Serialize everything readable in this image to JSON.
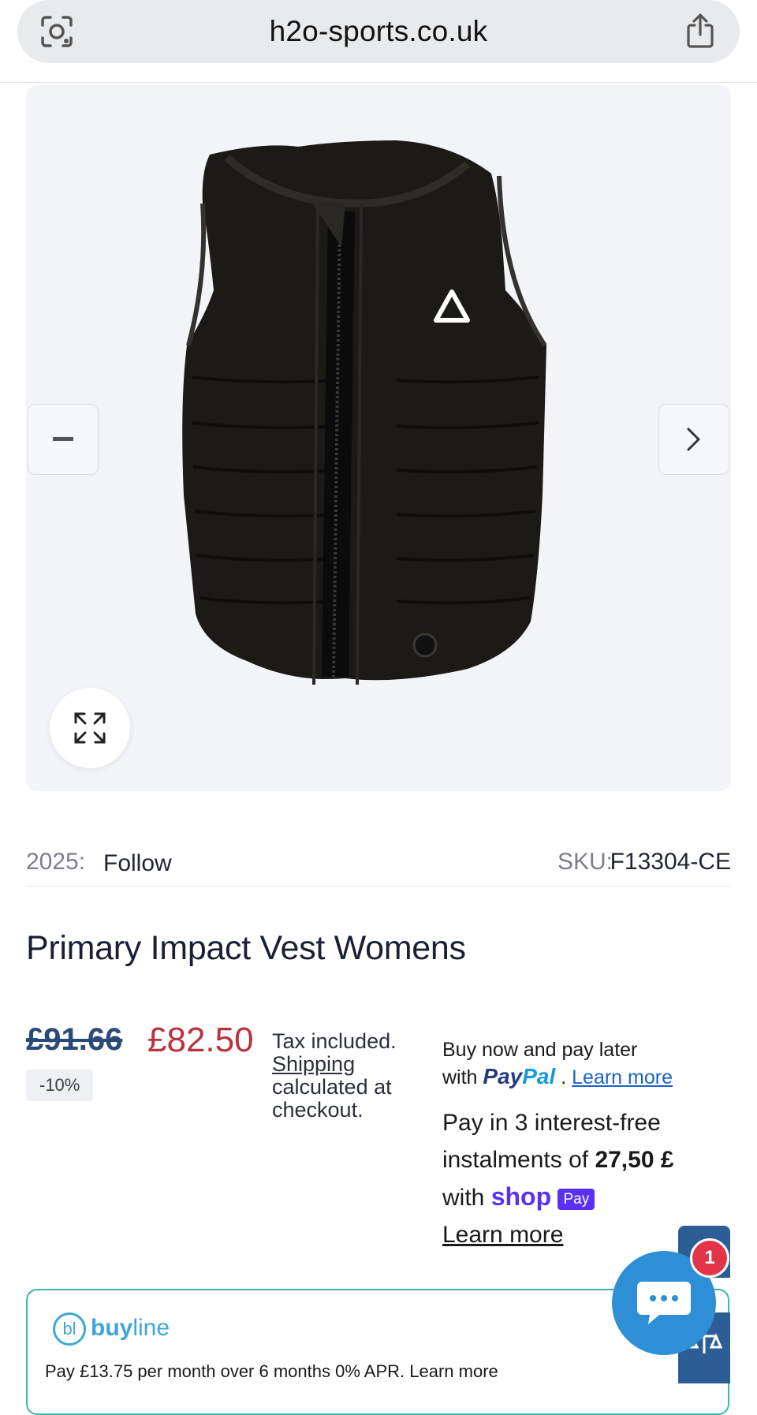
{
  "browser": {
    "url_domain": "h2o-sports.co.uk",
    "icons": {
      "lens": "camera-search-icon",
      "share": "share-icon"
    }
  },
  "gallery": {
    "image_alt": "Primary Impact Vest Womens",
    "prev_icon": "minus-icon",
    "next_icon": "chevron-right-icon",
    "zoom_icon": "expand-icon"
  },
  "meta": {
    "year_label": "2025:",
    "year_value": "Follow",
    "sku_label": "SKU:",
    "sku_value": "F13304-CE"
  },
  "product": {
    "title": "Primary Impact Vest Womens",
    "price_old": "£91.66",
    "price_new": "£82.50",
    "discount": "-10%",
    "tax_text": "Tax included.",
    "shipping_link": "Shipping",
    "tax_text_2": "calculated at checkout."
  },
  "paypal": {
    "line1": "Buy now and pay later",
    "with": "with",
    "logo_pay": "Pay",
    "logo_pal": "Pal",
    "sep": ".",
    "learn_more": "Learn more"
  },
  "shoppay": {
    "line1": "Pay in 3 interest-free instalments of",
    "amount": "27,50 £",
    "with": "with",
    "shop": "shop",
    "pay_badge": "Pay",
    "learn_more": "Learn more"
  },
  "buyline": {
    "logo_bl": "bl",
    "logo_buy": "buy",
    "logo_line": "line",
    "text": "Pay £13.75 per month over 6 months 0% APR. Learn more"
  },
  "chat": {
    "badge_count": "1",
    "icon": "chat-bubble-icon"
  },
  "colors": {
    "price_new": "#b8333c",
    "price_old": "#2a4a7a",
    "shop_pay": "#5a31f4",
    "chat": "#2f8fd6",
    "buyline_border": "#3bb6a8"
  }
}
